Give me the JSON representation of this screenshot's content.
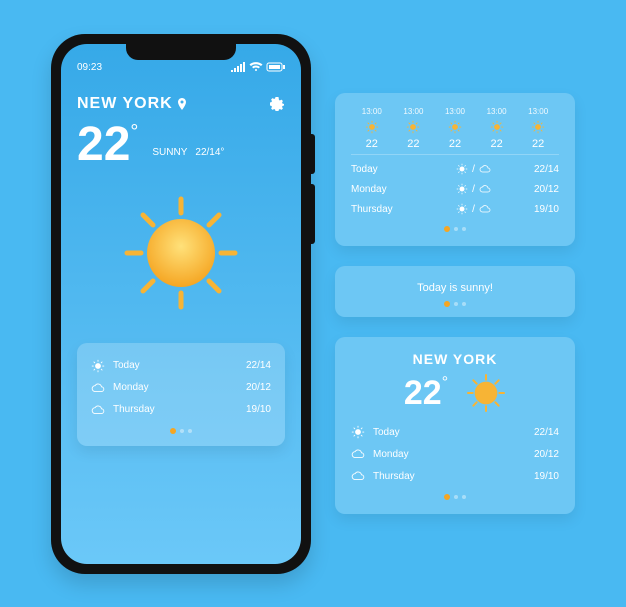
{
  "phone": {
    "time": "09:23",
    "city": "NEW YORK",
    "temp": "22",
    "condition": "SUNNY",
    "hilo": "22/14°",
    "forecast": [
      {
        "icon": "sun",
        "day": "Today",
        "hilo": "22/14"
      },
      {
        "icon": "cloud",
        "day": "Monday",
        "hilo": "20/12"
      },
      {
        "icon": "cloud",
        "day": "Thursday",
        "hilo": "19/10"
      }
    ]
  },
  "hourly": {
    "hours": [
      {
        "t": "13:00",
        "v": "22"
      },
      {
        "t": "13:00",
        "v": "22"
      },
      {
        "t": "13:00",
        "v": "22"
      },
      {
        "t": "13:00",
        "v": "22"
      },
      {
        "t": "13:00",
        "v": "22"
      }
    ],
    "days": [
      {
        "day": "Today",
        "icons": "sun-cloud",
        "hilo": "22/14"
      },
      {
        "day": "Monday",
        "icons": "sun-cloud",
        "hilo": "20/12"
      },
      {
        "day": "Thursday",
        "icons": "sun-cloud",
        "hilo": "19/10"
      }
    ]
  },
  "banner": {
    "text": "Today is sunny!"
  },
  "widget": {
    "city": "NEW YORK",
    "temp": "22",
    "days": [
      {
        "icon": "sun",
        "day": "Today",
        "hilo": "22/14"
      },
      {
        "icon": "cloud",
        "day": "Monday",
        "hilo": "20/12"
      },
      {
        "icon": "cloud",
        "day": "Thursday",
        "hilo": "19/10"
      }
    ]
  }
}
